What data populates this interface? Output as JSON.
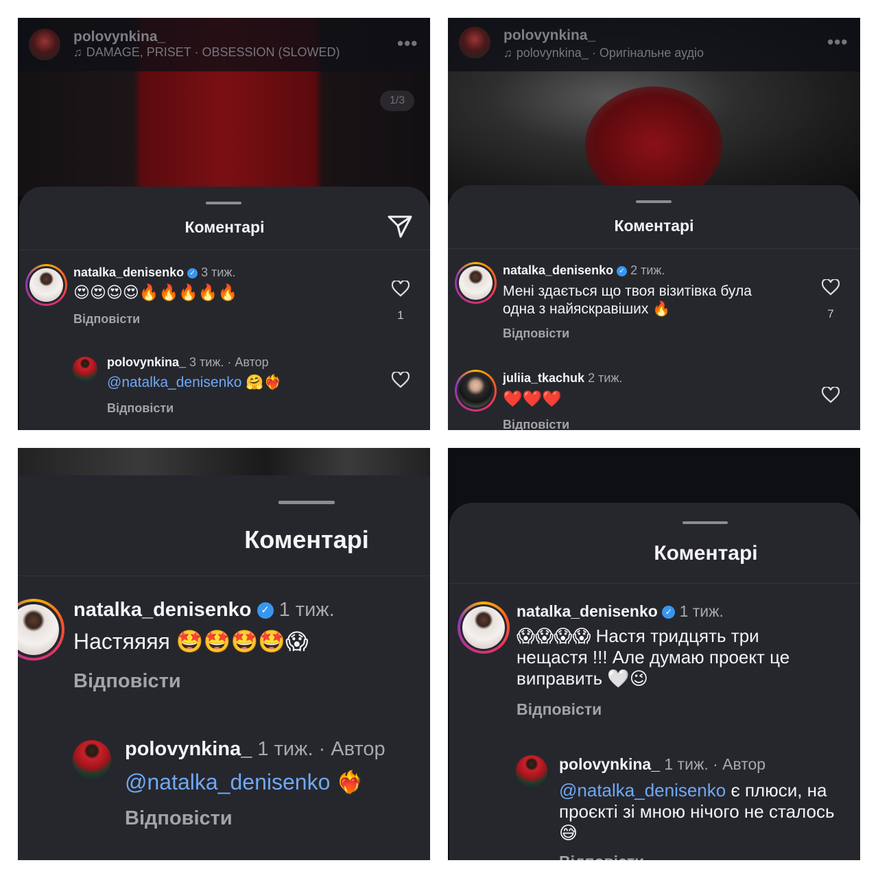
{
  "p1": {
    "topbar": {
      "username": "polovynkina_",
      "audio": "DAMAGE, PRISET · OBSESSION (SLOWED)",
      "more": "•••"
    },
    "counter": "1/3",
    "title": "Коментарі",
    "c1": {
      "user": "natalka_denisenko",
      "verified": "✓",
      "time": "3 тиж.",
      "text": "😍😍😍😍🔥🔥🔥🔥🔥",
      "reply": "Відповісти",
      "likes": "1"
    },
    "c2": {
      "user": "polovynkina_",
      "meta": "3 тиж. · Автор",
      "mention": "@natalka_denisenko",
      "rest": " 🤗❤️‍🔥",
      "reply": "Відповісти"
    }
  },
  "p2": {
    "topbar": {
      "username": "polovynkina_",
      "audio": "polovynkina_ · Оригінальне аудіо",
      "more": "•••"
    },
    "title": "Коментарі",
    "c1": {
      "user": "natalka_denisenko",
      "verified": "✓",
      "time": "2 тиж.",
      "line1": "Мені здається що твоя візитівка була",
      "line2": "одна з найяскравіших 🔥",
      "reply": "Відповісти",
      "likes": "7"
    },
    "c2": {
      "user": "juliia_tkachuk",
      "time": "2 тиж.",
      "text": "❤️❤️❤️",
      "reply": "Відповісти"
    }
  },
  "p3": {
    "title": "Коментарі",
    "c1": {
      "user": "natalka_denisenko",
      "verified": "✓",
      "time": "1 тиж.",
      "text": "Настяяяя 🤩🤩🤩🤩😱",
      "reply": "Відповісти"
    },
    "c2": {
      "user": "polovynkina_",
      "meta": "1 тиж. · Автор",
      "mention": "@natalka_denisenko",
      "rest": " ❤️‍🔥",
      "reply": "Відповісти"
    }
  },
  "p4": {
    "title": "Коментарі",
    "c1": {
      "user": "natalka_denisenko",
      "verified": "✓",
      "time": "1 тиж.",
      "line1": "😱😱😱😱 Настя тридцять три",
      "line2": "нещастя !!! Але думаю проект це",
      "line3": "виправить 🤍😉",
      "reply": "Відповісти"
    },
    "c2": {
      "user": "polovynkina_",
      "meta": "1 тиж. · Автор",
      "mention": "@natalka_denisenko",
      "rest": " є плюси, на",
      "line2": "проєкті зі мною нічого не сталось",
      "line3": "😅",
      "reply": "Відповісти"
    }
  },
  "colors": {
    "sheet": "#26272d",
    "mention": "#6fa8f5",
    "verified": "#3797f0"
  },
  "icons": [
    "music-note-icon",
    "more-icon",
    "send-icon",
    "heart-icon",
    "verified-badge-icon"
  ]
}
